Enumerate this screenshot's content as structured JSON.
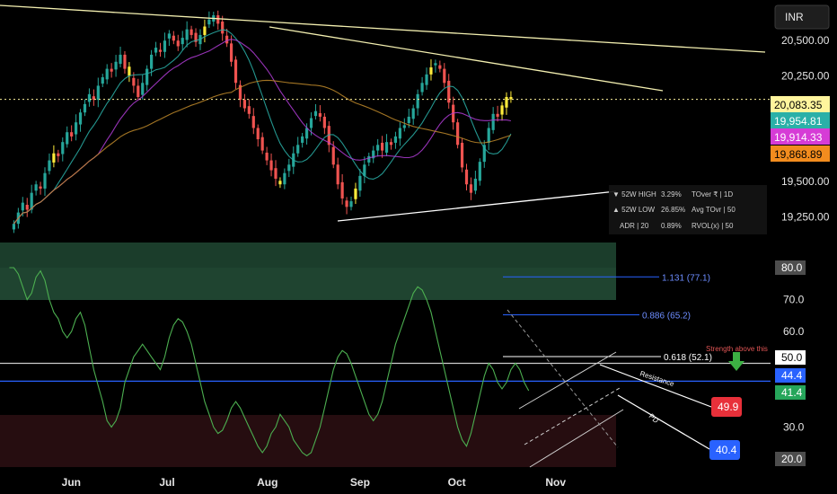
{
  "chart_data": {
    "type": "candlestick",
    "currency_label": "INR",
    "price_ticks": [
      20500,
      20250,
      19500,
      19250
    ],
    "price_tick_labels": [
      "20,500.00",
      "20,250.00",
      "19,500.00",
      "19,250.00"
    ],
    "price_range": [
      19080,
      20750
    ],
    "x_labels": [
      {
        "label": "Jun",
        "index": 14
      },
      {
        "label": "Jul",
        "index": 36
      },
      {
        "label": "Aug",
        "index": 58
      },
      {
        "label": "Sep",
        "index": 79
      },
      {
        "label": "Oct",
        "index": 101
      },
      {
        "label": "Nov",
        "index": 123
      }
    ],
    "total_slots": 138,
    "closes": [
      19200,
      19280,
      19350,
      19300,
      19420,
      19480,
      19450,
      19560,
      19650,
      19700,
      19680,
      19780,
      19850,
      19820,
      19920,
      19990,
      20050,
      20120,
      20080,
      20180,
      20240,
      20300,
      20280,
      20350,
      20400,
      20300,
      20250,
      20180,
      20100,
      20200,
      20300,
      20400,
      20450,
      20420,
      20500,
      20550,
      20500,
      20460,
      20520,
      20580,
      20540,
      20490,
      20540,
      20600,
      20650,
      20680,
      20620,
      20550,
      20480,
      20350,
      20200,
      20080,
      20020,
      19980,
      19880,
      19800,
      19720,
      19650,
      19580,
      19520,
      19480,
      19560,
      19620,
      19700,
      19760,
      19820,
      19880,
      19950,
      20000,
      19960,
      19880,
      19760,
      19620,
      19480,
      19380,
      19320,
      19360,
      19450,
      19540,
      19620,
      19680,
      19720,
      19760,
      19720,
      19780,
      19760,
      19820,
      19880,
      19900,
      19960,
      20020,
      20120,
      20200,
      20260,
      20310,
      20340,
      20300,
      20200,
      20060,
      19920,
      19760,
      19600,
      19480,
      19420,
      19520,
      19640,
      19760,
      19880,
      19980,
      19960,
      20040,
      20100,
      20083.35
    ],
    "first_index": 1,
    "last_price": {
      "label": "20,083.35",
      "color": "#fff59d"
    },
    "price_tags": [
      {
        "label": "20,083.35",
        "value": 20083.35,
        "bg": "#fff59d",
        "fg": "#000000"
      },
      {
        "label": "19,954.81",
        "value": 19954.81,
        "bg": "#2ab0a8",
        "fg": "#ffffff"
      },
      {
        "label": "19,914.33",
        "value": 19914.33,
        "bg": "#d63cd6",
        "fg": "#ffffff"
      },
      {
        "label": "19,868.89",
        "value": 19868.89,
        "bg": "#f28c1e",
        "fg": "#000000"
      }
    ],
    "stats_table": [
      [
        "▼ 52W HIGH",
        "3.29%",
        "TOver ₹ | 1D"
      ],
      [
        "▲ 52W LOW",
        "26.85%",
        "Avg TOvr | 50"
      ],
      [
        "ADR | 20",
        "0.89%",
        "RVOL(x) | 50"
      ]
    ],
    "oscillator": {
      "range": [
        20,
        80
      ],
      "tick_labels": [
        "80.0",
        "70.0",
        "60.0",
        "50.0",
        "40.0",
        "30.0",
        "20.0"
      ],
      "tick_values": [
        80,
        70,
        60,
        50,
        40,
        30,
        20
      ],
      "values": [
        80,
        80,
        78,
        74,
        70,
        72,
        77,
        79,
        76,
        70,
        66,
        64,
        60,
        58,
        60,
        64,
        66,
        62,
        55,
        48,
        43,
        38,
        32,
        30,
        32,
        36,
        44,
        48,
        52,
        54,
        56,
        54,
        52,
        50,
        48,
        52,
        58,
        62,
        64,
        63,
        60,
        56,
        50,
        44,
        38,
        34,
        30,
        28,
        29,
        32,
        36,
        38,
        36,
        33,
        30,
        27,
        24,
        22,
        24,
        28,
        30,
        34,
        32,
        30,
        26,
        24,
        22,
        21,
        22,
        26,
        30,
        36,
        42,
        48,
        52,
        54,
        53,
        50,
        46,
        42,
        38,
        34,
        32,
        34,
        38,
        44,
        50,
        56,
        60,
        64,
        68,
        72,
        74,
        73,
        70,
        66,
        60,
        54,
        48,
        42,
        36,
        30,
        26,
        24,
        28,
        34,
        40,
        46,
        50,
        48,
        44,
        42,
        44,
        48,
        50,
        48,
        44,
        41.4
      ],
      "fib_levels": [
        {
          "label": "1.131 (77.1)",
          "value": 77.1
        },
        {
          "label": "0.886 (65.2)",
          "value": 65.2
        },
        {
          "label": "0.618 (52.1)",
          "value": 52.1
        }
      ],
      "tags": [
        {
          "label": "80.0",
          "value": 80,
          "bg": "#4d4d4d",
          "fg": "#ffffff"
        },
        {
          "label": "50.0",
          "value": 50,
          "bg": "#ffffff",
          "fg": "#000000"
        },
        {
          "label": "44.4",
          "value": 44.4,
          "bg": "#2962ff",
          "fg": "#ffffff"
        },
        {
          "label": "41.4",
          "value": 41.4,
          "bg": "#26a65b",
          "fg": "#ffffff"
        },
        {
          "label": "20.0",
          "value": 20,
          "bg": "#4d4d4d",
          "fg": "#ffffff"
        }
      ],
      "blue_line": 44.4,
      "white_line": 50,
      "annotations": {
        "strength": "Strength above this",
        "resistance": "Resistance",
        "pd": "PD",
        "target_red": "49.9",
        "target_blue": "40.4"
      }
    },
    "colors": {
      "up": "#26a69a",
      "down": "#ef5350",
      "highlight": "#ffeb3b"
    }
  }
}
